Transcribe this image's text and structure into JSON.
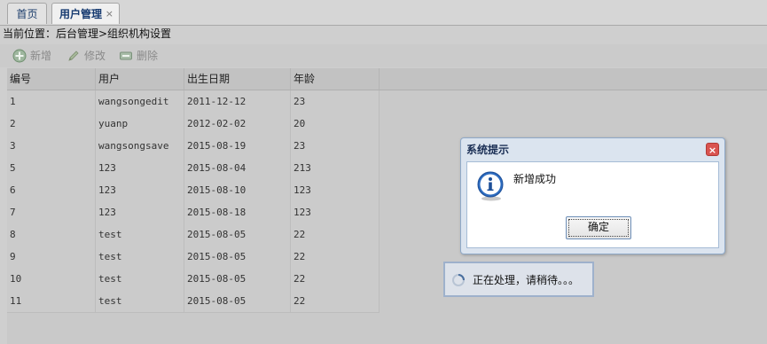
{
  "tabs": {
    "home_label": "首页",
    "active_label": "用户管理",
    "close_symbol": "×"
  },
  "breadcrumb": "当前位置：后台管理>组织机构设置",
  "toolbar": {
    "add_label": "新增",
    "edit_label": "修改",
    "delete_label": "删除"
  },
  "table": {
    "columns": [
      "编号",
      "用户",
      "出生日期",
      "年龄"
    ],
    "rows": [
      [
        "1",
        "wangsongedit",
        "2011-12-12",
        "23"
      ],
      [
        "2",
        "yuanp",
        "2012-02-02",
        "20"
      ],
      [
        "3",
        "wangsongsave",
        "2015-08-19",
        "23"
      ],
      [
        "5",
        "123",
        "2015-08-04",
        "213"
      ],
      [
        "6",
        "123",
        "2015-08-10",
        "123"
      ],
      [
        "7",
        "123",
        "2015-08-18",
        "123"
      ],
      [
        "8",
        "test",
        "2015-08-05",
        "22"
      ],
      [
        "9",
        "test",
        "2015-08-05",
        "22"
      ],
      [
        "10",
        "test",
        "2015-08-05",
        "22"
      ],
      [
        "11",
        "test",
        "2015-08-05",
        "22"
      ]
    ]
  },
  "dialog": {
    "title": "系统提示",
    "message": "新增成功",
    "ok_label": "确定",
    "icon": "info-icon"
  },
  "loading": {
    "text": "正在处理，请稍待。。。"
  },
  "colors": {
    "dialog_title": "#1b2f55",
    "close_button": "#d9534f",
    "info_icon": "#2d6cc0",
    "add_icon": "#4caf50"
  }
}
